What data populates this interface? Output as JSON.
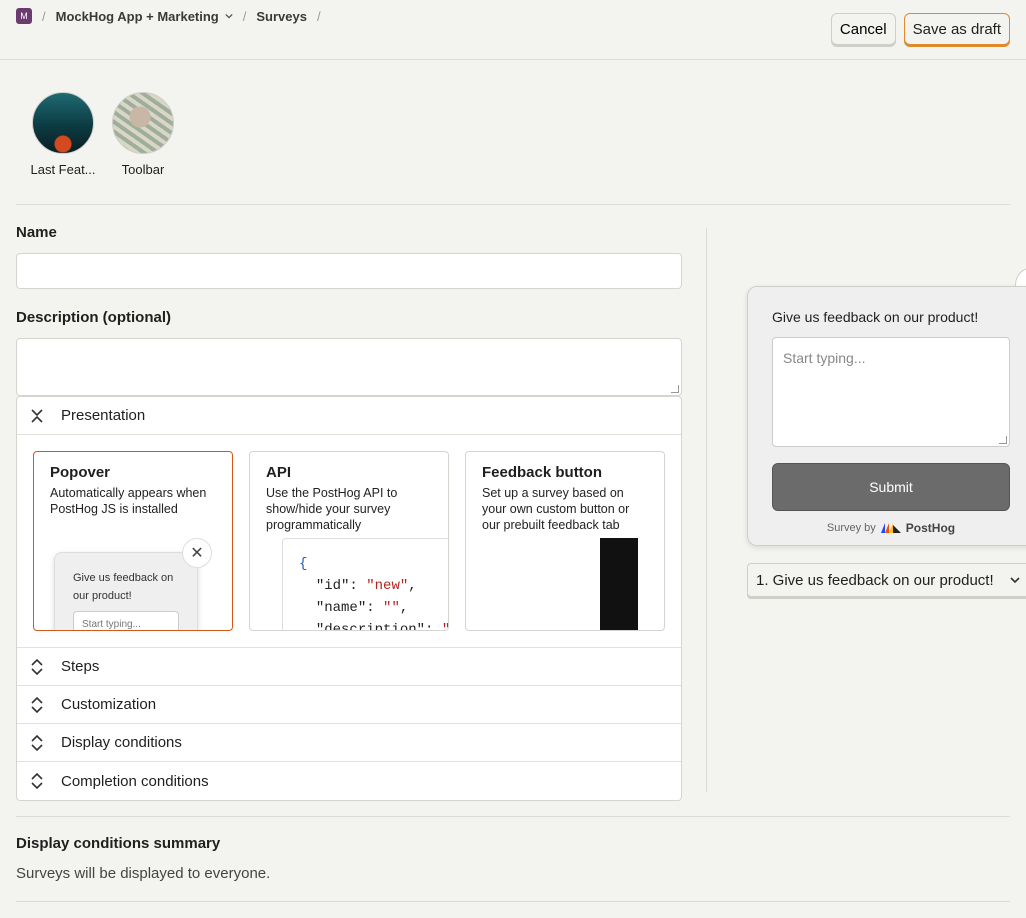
{
  "breadcrumb": {
    "org_initial": "M",
    "project": "MockHog App + Marketing",
    "section": "Surveys"
  },
  "actions": {
    "cancel": "Cancel",
    "save_draft": "Save as draft"
  },
  "templates": [
    {
      "label": "Last Feat..."
    },
    {
      "label": "Toolbar"
    }
  ],
  "form": {
    "name_label": "Name",
    "name_value": "",
    "description_label": "Description (optional)",
    "description_value": ""
  },
  "accordion": {
    "presentation": "Presentation",
    "steps": "Steps",
    "customization": "Customization",
    "display_conditions": "Display conditions",
    "completion_conditions": "Completion conditions"
  },
  "presentation_options": {
    "popover": {
      "title": "Popover",
      "desc": "Automatically appears when PostHog JS is installed",
      "mini_question": "Give us feedback on our product!",
      "mini_placeholder": "Start typing..."
    },
    "api": {
      "title": "API",
      "desc": "Use the PostHog API to show/hide your survey programmatically",
      "code_brace": "{",
      "code_key1": "\"id\"",
      "code_val1": "\"new\"",
      "code_key2": "\"name\"",
      "code_val2": "\"\"",
      "code_key3": "\"description\"",
      "code_val3": "\""
    },
    "feedback_button": {
      "title": "Feedback button",
      "desc": "Set up a survey based on your own custom button or our prebuilt feedback tab"
    }
  },
  "preview": {
    "question": "Give us feedback on our product!",
    "placeholder": "Start typing...",
    "submit": "Submit",
    "survey_by": "Survey by",
    "brand": "PostHog",
    "question_select": "1. Give us feedback on our product!"
  },
  "summary": {
    "title": "Display conditions summary",
    "text": "Surveys will be displayed to everyone."
  },
  "colors": {
    "accent": "#e08b2b",
    "selected_border": "#d2591a",
    "submit_bg": "#6b6b6b"
  }
}
